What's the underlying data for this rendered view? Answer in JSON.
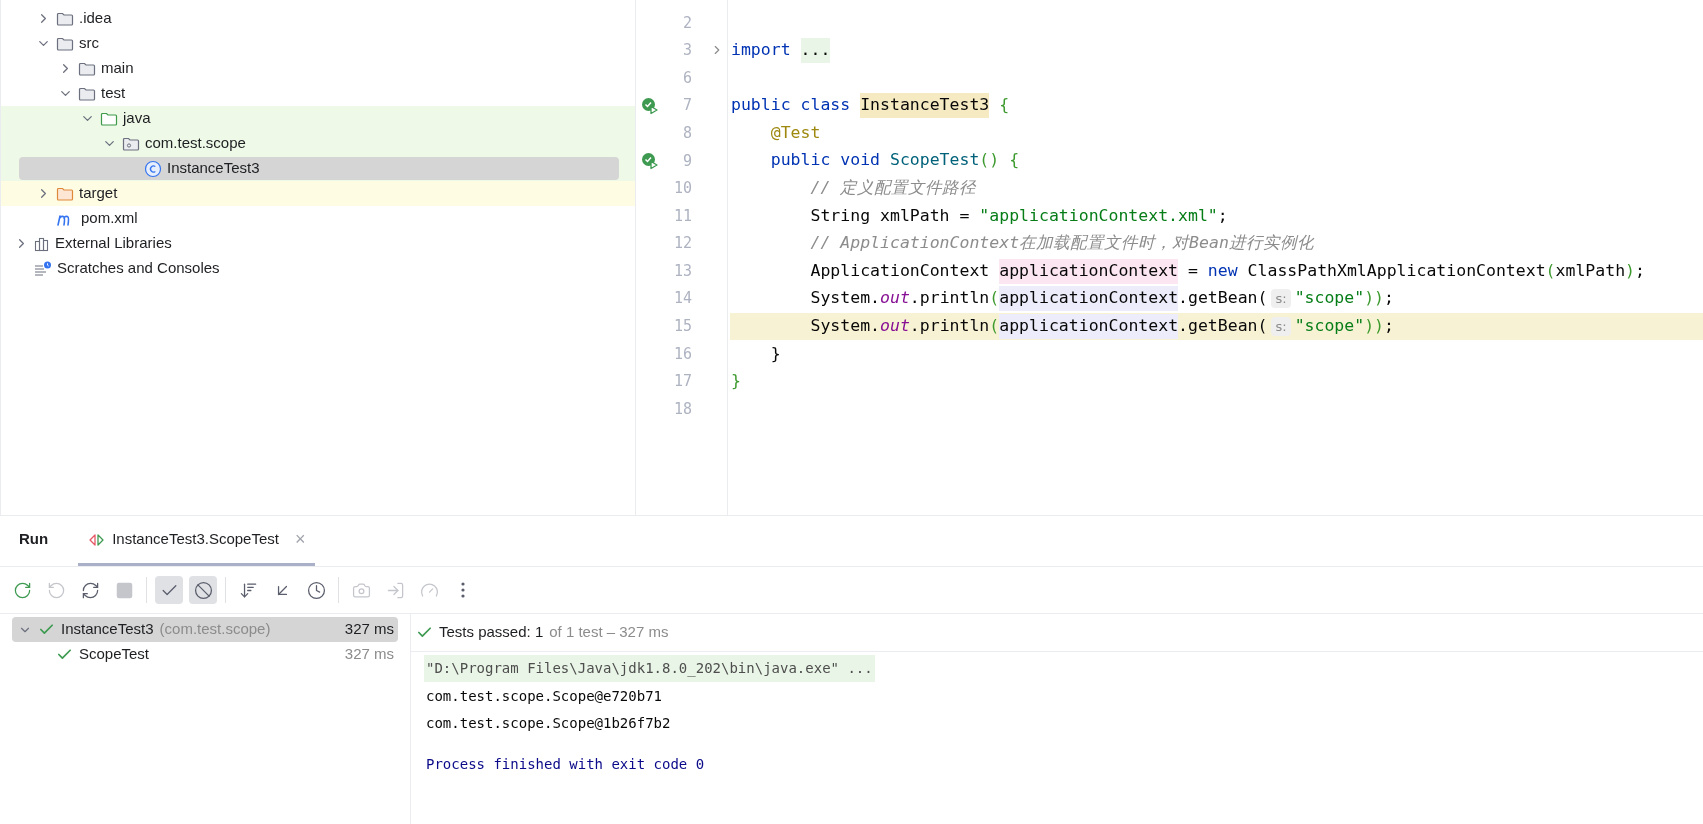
{
  "project_tree": {
    "root_children": [
      {
        "label": ".idea",
        "kind": "folder",
        "expanded": false,
        "selected": false,
        "test_source": false,
        "excluded": false
      },
      {
        "label": "src",
        "kind": "folder",
        "expanded": true,
        "selected": false,
        "test_source": false,
        "excluded": false,
        "children": [
          {
            "label": "main",
            "kind": "folder",
            "expanded": false,
            "selected": false,
            "test_source": false,
            "excluded": false
          },
          {
            "label": "test",
            "kind": "folder",
            "expanded": true,
            "selected": false,
            "test_source": false,
            "excluded": false,
            "children": [
              {
                "label": "java",
                "kind": "test_folder",
                "expanded": true,
                "selected": false,
                "test_source": true,
                "excluded": false,
                "children": [
                  {
                    "label": "com.test.scope",
                    "kind": "package",
                    "expanded": true,
                    "selected": false,
                    "test_source": true,
                    "excluded": false,
                    "children": [
                      {
                        "label": "InstanceTest3",
                        "kind": "class",
                        "selected": true,
                        "test_source": true,
                        "excluded": false
                      }
                    ]
                  }
                ]
              }
            ]
          }
        ]
      },
      {
        "label": "target",
        "kind": "excluded_folder",
        "expanded": false,
        "selected": false,
        "test_source": false,
        "excluded": true
      },
      {
        "label": "pom.xml",
        "kind": "maven",
        "selected": false,
        "test_source": false,
        "excluded": false
      }
    ],
    "items": [
      {
        "label": "External Libraries",
        "kind": "libraries",
        "expanded": false,
        "selected": false,
        "test_source": false,
        "excluded": false
      },
      {
        "label": "Scratches and Consoles",
        "kind": "scratches",
        "selected": false,
        "test_source": false,
        "excluded": false
      }
    ]
  },
  "editor": {
    "lines": [
      {
        "number": "2",
        "current": false
      },
      {
        "number": "3",
        "current": false,
        "folded": true,
        "tokens": [
          {
            "text": "import ",
            "kind": "keyword"
          },
          {
            "text": "...",
            "kind": "folded"
          }
        ]
      },
      {
        "number": "6",
        "current": false
      },
      {
        "number": "7",
        "current": false,
        "run_icon": true,
        "tokens": [
          {
            "text": "public class ",
            "kind": "keyword"
          },
          {
            "text": "InstanceTest3",
            "kind": "declaration"
          },
          {
            "text": " {",
            "kind": "brace"
          }
        ]
      },
      {
        "number": "8",
        "current": false,
        "tokens": [
          {
            "text": "    @Test",
            "kind": "annotation"
          }
        ]
      },
      {
        "number": "9",
        "current": false,
        "run_icon": true,
        "tokens": [
          {
            "text": "    public void ",
            "kind": "keyword"
          },
          {
            "text": "ScopeTest",
            "kind": "method"
          },
          {
            "text": "() {",
            "kind": "brace"
          }
        ]
      },
      {
        "number": "10",
        "current": false,
        "tokens": [
          {
            "text": "        // 定义配置文件路径",
            "kind": "comment"
          }
        ]
      },
      {
        "number": "11",
        "current": false,
        "tokens": [
          {
            "text": "        String xmlPath = ",
            "kind": "plain"
          },
          {
            "text": "\"applicationContext.xml\"",
            "kind": "string"
          },
          {
            "text": ";",
            "kind": "plain"
          }
        ]
      },
      {
        "number": "12",
        "current": false,
        "tokens": [
          {
            "text": "        // ApplicationContext在加载配置文件时，对Bean进行实例化",
            "kind": "comment"
          }
        ]
      },
      {
        "number": "13",
        "current": false,
        "tokens": [
          {
            "text": "        ApplicationContext ",
            "kind": "plain"
          },
          {
            "text": "applicationContext",
            "kind": "write_usage"
          },
          {
            "text": " = ",
            "kind": "plain"
          },
          {
            "text": "new",
            "kind": "keyword"
          },
          {
            "text": " ClassPathXmlApplicationContext",
            "kind": "plain"
          },
          {
            "text": "(",
            "kind": "brace"
          },
          {
            "text": "xmlPath",
            "kind": "plain"
          },
          {
            "text": ")",
            "kind": "brace"
          },
          {
            "text": ";",
            "kind": "plain"
          }
        ]
      },
      {
        "number": "14",
        "current": false,
        "tokens": [
          {
            "text": "        System.",
            "kind": "plain"
          },
          {
            "text": "out",
            "kind": "static"
          },
          {
            "text": ".println",
            "kind": "plain"
          },
          {
            "text": "(",
            "kind": "brace"
          },
          {
            "text": "applicationContext",
            "kind": "read_usage"
          },
          {
            "text": ".getBean(",
            "kind": "plain"
          },
          {
            "text": "s:",
            "kind": "hint"
          },
          {
            "text": "\"scope\"",
            "kind": "string"
          },
          {
            "text": "))",
            "kind": "brace"
          },
          {
            "text": ";",
            "kind": "plain"
          }
        ]
      },
      {
        "number": "15",
        "current": true,
        "tokens": [
          {
            "text": "        System.",
            "kind": "plain"
          },
          {
            "text": "out",
            "kind": "static"
          },
          {
            "text": ".println",
            "kind": "plain"
          },
          {
            "text": "(",
            "kind": "brace"
          },
          {
            "text": "applicationContext",
            "kind": "read_usage"
          },
          {
            "text": ".getBean(",
            "kind": "plain"
          },
          {
            "text": "s:",
            "kind": "hint"
          },
          {
            "text": "\"scope\"",
            "kind": "string"
          },
          {
            "text": "))",
            "kind": "brace"
          },
          {
            "text": ";",
            "kind": "plain"
          }
        ]
      },
      {
        "number": "16",
        "current": false,
        "tokens": [
          {
            "text": "    }",
            "kind": "brace_plain"
          }
        ]
      },
      {
        "number": "17",
        "current": false,
        "tokens": [
          {
            "text": "}",
            "kind": "brace"
          }
        ]
      },
      {
        "number": "18",
        "current": false
      }
    ]
  },
  "run_panel": {
    "title": "Run",
    "tabs": [
      {
        "label": "InstanceTest3.ScopeTest",
        "selected": true,
        "close": "×"
      }
    ],
    "toolbar": [
      {
        "kind": "rerun",
        "on": false,
        "disabled": false
      },
      {
        "kind": "rerun_failed",
        "on": false,
        "disabled": true
      },
      {
        "kind": "auto_test",
        "on": false,
        "disabled": false
      },
      {
        "kind": "stop",
        "on": false,
        "disabled": true
      },
      {
        "kind": "separator"
      },
      {
        "kind": "show_passed",
        "on": true,
        "disabled": false
      },
      {
        "kind": "show_ignored",
        "on": true,
        "disabled": false
      },
      {
        "kind": "separator"
      },
      {
        "kind": "sort",
        "on": false,
        "disabled": false
      },
      {
        "kind": "import",
        "on": false,
        "disabled": false
      },
      {
        "kind": "history",
        "on": false,
        "disabled": false
      },
      {
        "kind": "separator"
      },
      {
        "kind": "screenshot",
        "on": false,
        "disabled": true
      },
      {
        "kind": "export",
        "on": false,
        "disabled": true
      },
      {
        "kind": "coverage",
        "on": false,
        "disabled": true
      },
      {
        "kind": "more",
        "on": false,
        "disabled": false
      }
    ],
    "results": [
      {
        "name": "InstanceTest3",
        "package": "(com.test.scope)",
        "time": "327 ms",
        "passed": true,
        "selected": true,
        "expanded": true,
        "children": [
          {
            "name": "ScopeTest",
            "time": "327 ms",
            "passed": true,
            "selected": false
          }
        ]
      }
    ],
    "status": {
      "passed": true,
      "label": "Tests passed: 1",
      "detail": "of 1 test – 327 ms"
    },
    "console": [
      {
        "kind": "command",
        "text": "\"D:\\Program Files\\Java\\jdk1.8.0_202\\bin\\java.exe\" ..."
      },
      {
        "kind": "output",
        "text": "com.test.scope.Scope@e720b71"
      },
      {
        "kind": "output",
        "text": "com.test.scope.Scope@1b26f7b2"
      },
      {
        "kind": "exit",
        "text": "Process finished with exit code 0"
      }
    ]
  }
}
